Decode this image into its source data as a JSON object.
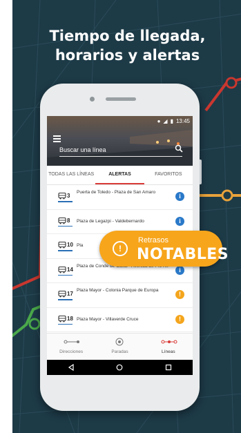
{
  "headline": {
    "line1": "Tiempo de llegada,",
    "line2": "horarios y alertas"
  },
  "status": {
    "time": "13:45"
  },
  "search": {
    "placeholder": "Buscar una línea"
  },
  "tabs": [
    {
      "label": "TODAS LAS LÍNEAS"
    },
    {
      "label": "ALERTAS"
    },
    {
      "label": "FAVORITOS"
    }
  ],
  "lines": [
    {
      "number": "3",
      "route": "Puerta de Toledo - Plaza de San Amaro",
      "status": "info"
    },
    {
      "number": "8",
      "route": "Plaza de Legazpi - Valdebernardo",
      "status": "info"
    },
    {
      "number": "10",
      "route": "Pla",
      "status": "info"
    },
    {
      "number": "14",
      "route": "Plaza de Conde de Casal - Avenida de Pío XII",
      "status": "info"
    },
    {
      "number": "17",
      "route": "Plaza Mayor - Colonia Parque de Europa",
      "status": "warning"
    },
    {
      "number": "18",
      "route": "Plaza Mayor - Villaverde Cruce",
      "status": "warning"
    }
  ],
  "bottom_nav": [
    {
      "label": "Direcciones"
    },
    {
      "label": "Paradas"
    },
    {
      "label": "Líneas"
    }
  ],
  "callout": {
    "small": "Retrasos",
    "big": "NOTABLES",
    "icon": "!"
  },
  "colors": {
    "background": "#1d3a47",
    "accent": "#d93a36",
    "warning": "#f7a51b",
    "info": "#2a79c9"
  }
}
